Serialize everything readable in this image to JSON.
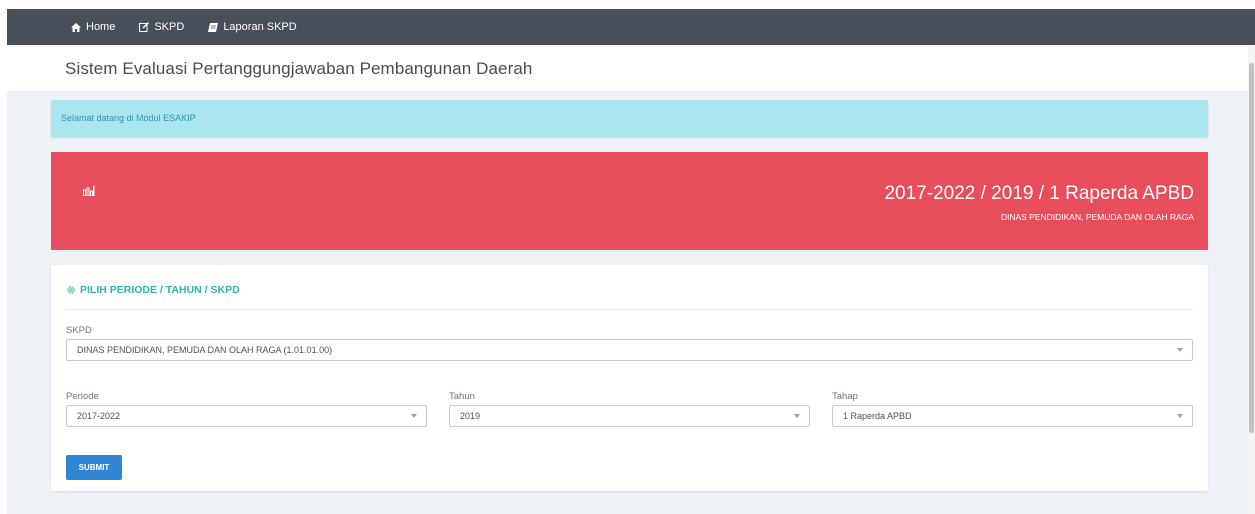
{
  "nav": {
    "items": [
      {
        "label": "Home",
        "icon": "home-icon"
      },
      {
        "label": "SKPD",
        "icon": "edit-icon"
      },
      {
        "label": "Laporan SKPD",
        "icon": "book-icon"
      }
    ]
  },
  "header": {
    "title": "Sistem Evaluasi Pertanggungjawaban Pembangunan Daerah"
  },
  "alert": {
    "text": "Selamat datang di Modul ESAKIP"
  },
  "banner": {
    "title": "2017-2022 / 2019 / 1 Raperda APBD",
    "subtitle": "DINAS PENDIDIKAN, PEMUDA DAN OLAH RAGA",
    "icon": "bar-chart-icon",
    "color": "#e74d5b"
  },
  "form": {
    "title": "PILIH PERIODE / TAHUN / SKPD",
    "title_icon": "gear-icon",
    "skpd": {
      "label": "SKPD",
      "value": "DINAS PENDIDIKAN, PEMUDA DAN OLAH RAGA (1.01.01.00)"
    },
    "periode": {
      "label": "Periode",
      "value": "2017-2022"
    },
    "tahun": {
      "label": "Tahun",
      "value": "2019"
    },
    "tahap": {
      "label": "Tahap",
      "value": "1 Raperda APBD"
    },
    "submit_label": "SUBMIT"
  },
  "colors": {
    "topbar": "#474f5b",
    "accent_teal": "#32b3a7",
    "alert_bg": "#abe5ef",
    "button_blue": "#2f86d4"
  }
}
